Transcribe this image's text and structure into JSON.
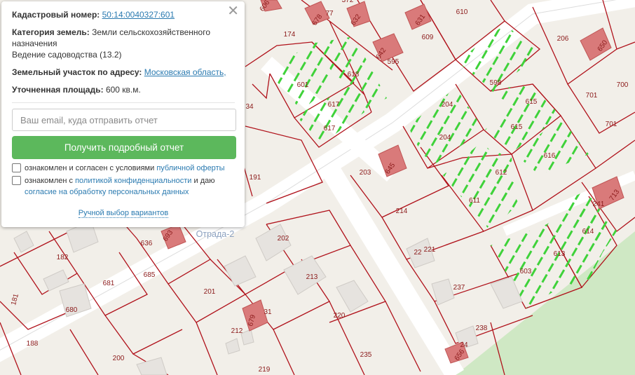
{
  "map": {
    "parcels": [
      "174",
      "77",
      "372",
      "632",
      "631",
      "610",
      "606",
      "678",
      "601",
      "618",
      "642",
      "595",
      "609",
      "598",
      "617",
      "204",
      "615",
      "206",
      "650",
      "701",
      "700",
      "191",
      "203",
      "645",
      "612",
      "616",
      "241",
      "713",
      "214",
      "611",
      "614",
      "613",
      "603",
      "221",
      "22",
      "237",
      "636",
      "693",
      "182",
      "681",
      "685",
      "201",
      "213",
      "202",
      "680",
      "181",
      "679",
      "31",
      "212",
      "220",
      "188",
      "200",
      "219",
      "235",
      "238",
      "24",
      "656",
      "34"
    ],
    "place_label": "Отрада-2"
  },
  "popup": {
    "cadastral_label": "Кадастровый номер:",
    "cadastral_number": "50:14:0040327:601",
    "category_label": "Категория земель:",
    "category_value": "Земли сельскохозяйственного назначения",
    "use_value": "Ведение садоводства (13.2)",
    "address_label": "Земельный участок по адресу:",
    "address_value": "Московская область,",
    "area_label": "Уточненная площадь:",
    "area_value": "600 кв.м.",
    "email_placeholder": "Ваш email, куда отправить отчет",
    "report_button": "Получить подробный отчет",
    "consent1_prefix": "ознакомлен и согласен с условиями",
    "consent1_link": "публичной оферты",
    "consent2_prefix": "ознакомлен с",
    "consent2_link1": "политикой конфиденциальности",
    "consent2_mid": "и даю",
    "consent2_link2": "согласие на обработку персональных данных",
    "manual_link": "Ручной выбор вариантов"
  },
  "colors": {
    "boundary": "#b0121b",
    "hatch": "#3fd23a",
    "road": "#dcdcdc",
    "button": "#5cb85c",
    "link": "#2a7ab0"
  }
}
